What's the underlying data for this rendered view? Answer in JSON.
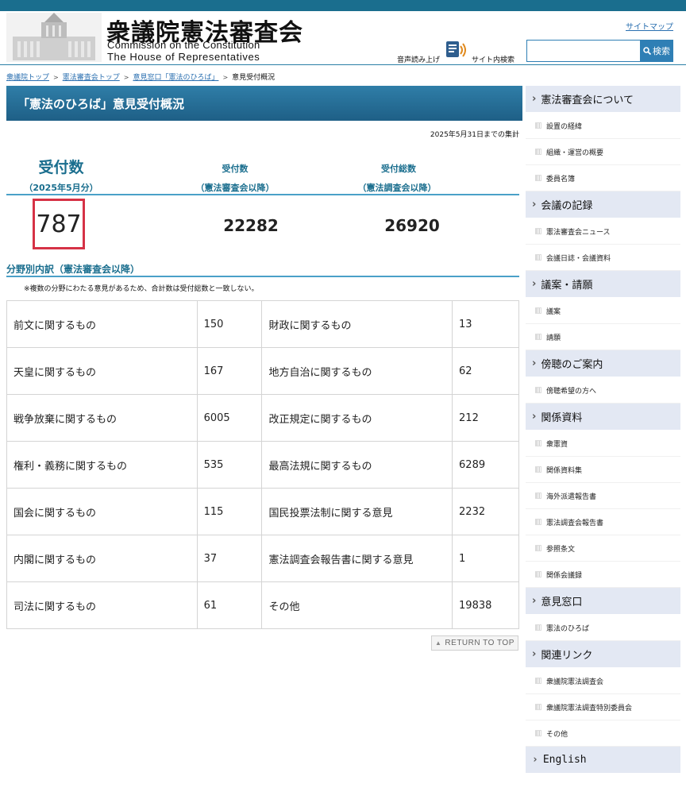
{
  "header": {
    "logo_jp": "衆議院憲法審査会",
    "logo_en_line1": "Commission on the Constitution",
    "logo_en_line2": "The House of  Representatives",
    "sitemap": "サイトマップ",
    "voice_label": "音声読み上げ",
    "site_search_label": "サイト内検索",
    "search_placeholder": "",
    "search_button": "検索"
  },
  "breadcrumb": {
    "items": [
      "衆議院トップ",
      "憲法審査会トップ",
      "意見窓口「憲法のひろば」"
    ],
    "current": "意見受付概況"
  },
  "page_title": "「憲法のひろば」意見受付概況",
  "as_of": "2025年5月31日までの集計",
  "stats": {
    "monthly_label": "受付数",
    "monthly_sub": "（2025年5月分）",
    "monthly_value": "787",
    "since_review_label": "受付数",
    "since_review_sub": "（憲法審査会以降）",
    "since_review_value": "22282",
    "total_label": "受付総数",
    "total_sub": "（憲法調査会以降）",
    "total_value": "26920"
  },
  "breakdown": {
    "title": "分野別内訳（憲法審査会以降）",
    "note": "※複数の分野にわたる意見があるため、合計数は受付総数と一致しない。",
    "rows": [
      {
        "cat1": "前文に関するもの",
        "val1": "150",
        "cat2": "財政に関するもの",
        "val2": "13"
      },
      {
        "cat1": "天皇に関するもの",
        "val1": "167",
        "cat2": "地方自治に関するもの",
        "val2": "62"
      },
      {
        "cat1": "戦争放棄に関するもの",
        "val1": "6005",
        "cat2": "改正規定に関するもの",
        "val2": "212"
      },
      {
        "cat1": "権利・義務に関するもの",
        "val1": "535",
        "cat2": "最高法規に関するもの",
        "val2": "6289"
      },
      {
        "cat1": "国会に関するもの",
        "val1": "115",
        "cat2": "国民投票法制に関する意見",
        "val2": "2232"
      },
      {
        "cat1": "内閣に関するもの",
        "val1": "37",
        "cat2": "憲法調査会報告書に関する意見",
        "val2": "1"
      },
      {
        "cat1": "司法に関するもの",
        "val1": "61",
        "cat2": "その他",
        "val2": "19838"
      }
    ]
  },
  "return_top": "RETURN TO TOP",
  "sidebar": {
    "sections": [
      {
        "title": "憲法審査会について",
        "items": [
          "設置の経緯",
          "組織・運営の概要",
          "委員名簿"
        ]
      },
      {
        "title": "会議の記録",
        "items": [
          "憲法審査会ニュース",
          "会議日誌・会議資料"
        ]
      },
      {
        "title": "議案・請願",
        "items": [
          "議案",
          "請願"
        ]
      },
      {
        "title": "傍聴のご案内",
        "items": [
          "傍聴希望の方へ"
        ]
      },
      {
        "title": "関係資料",
        "items": [
          "衆憲資",
          "関係資料集",
          "海外派遣報告書",
          "憲法調査会報告書",
          "参照条文",
          "関係会議録"
        ]
      },
      {
        "title": "意見窓口",
        "items": [
          "憲法のひろば"
        ]
      },
      {
        "title": "関連リンク",
        "items": [
          "衆議院憲法調査会",
          "衆議院憲法調査特別委員会",
          "その他"
        ]
      }
    ],
    "english": "English"
  }
}
